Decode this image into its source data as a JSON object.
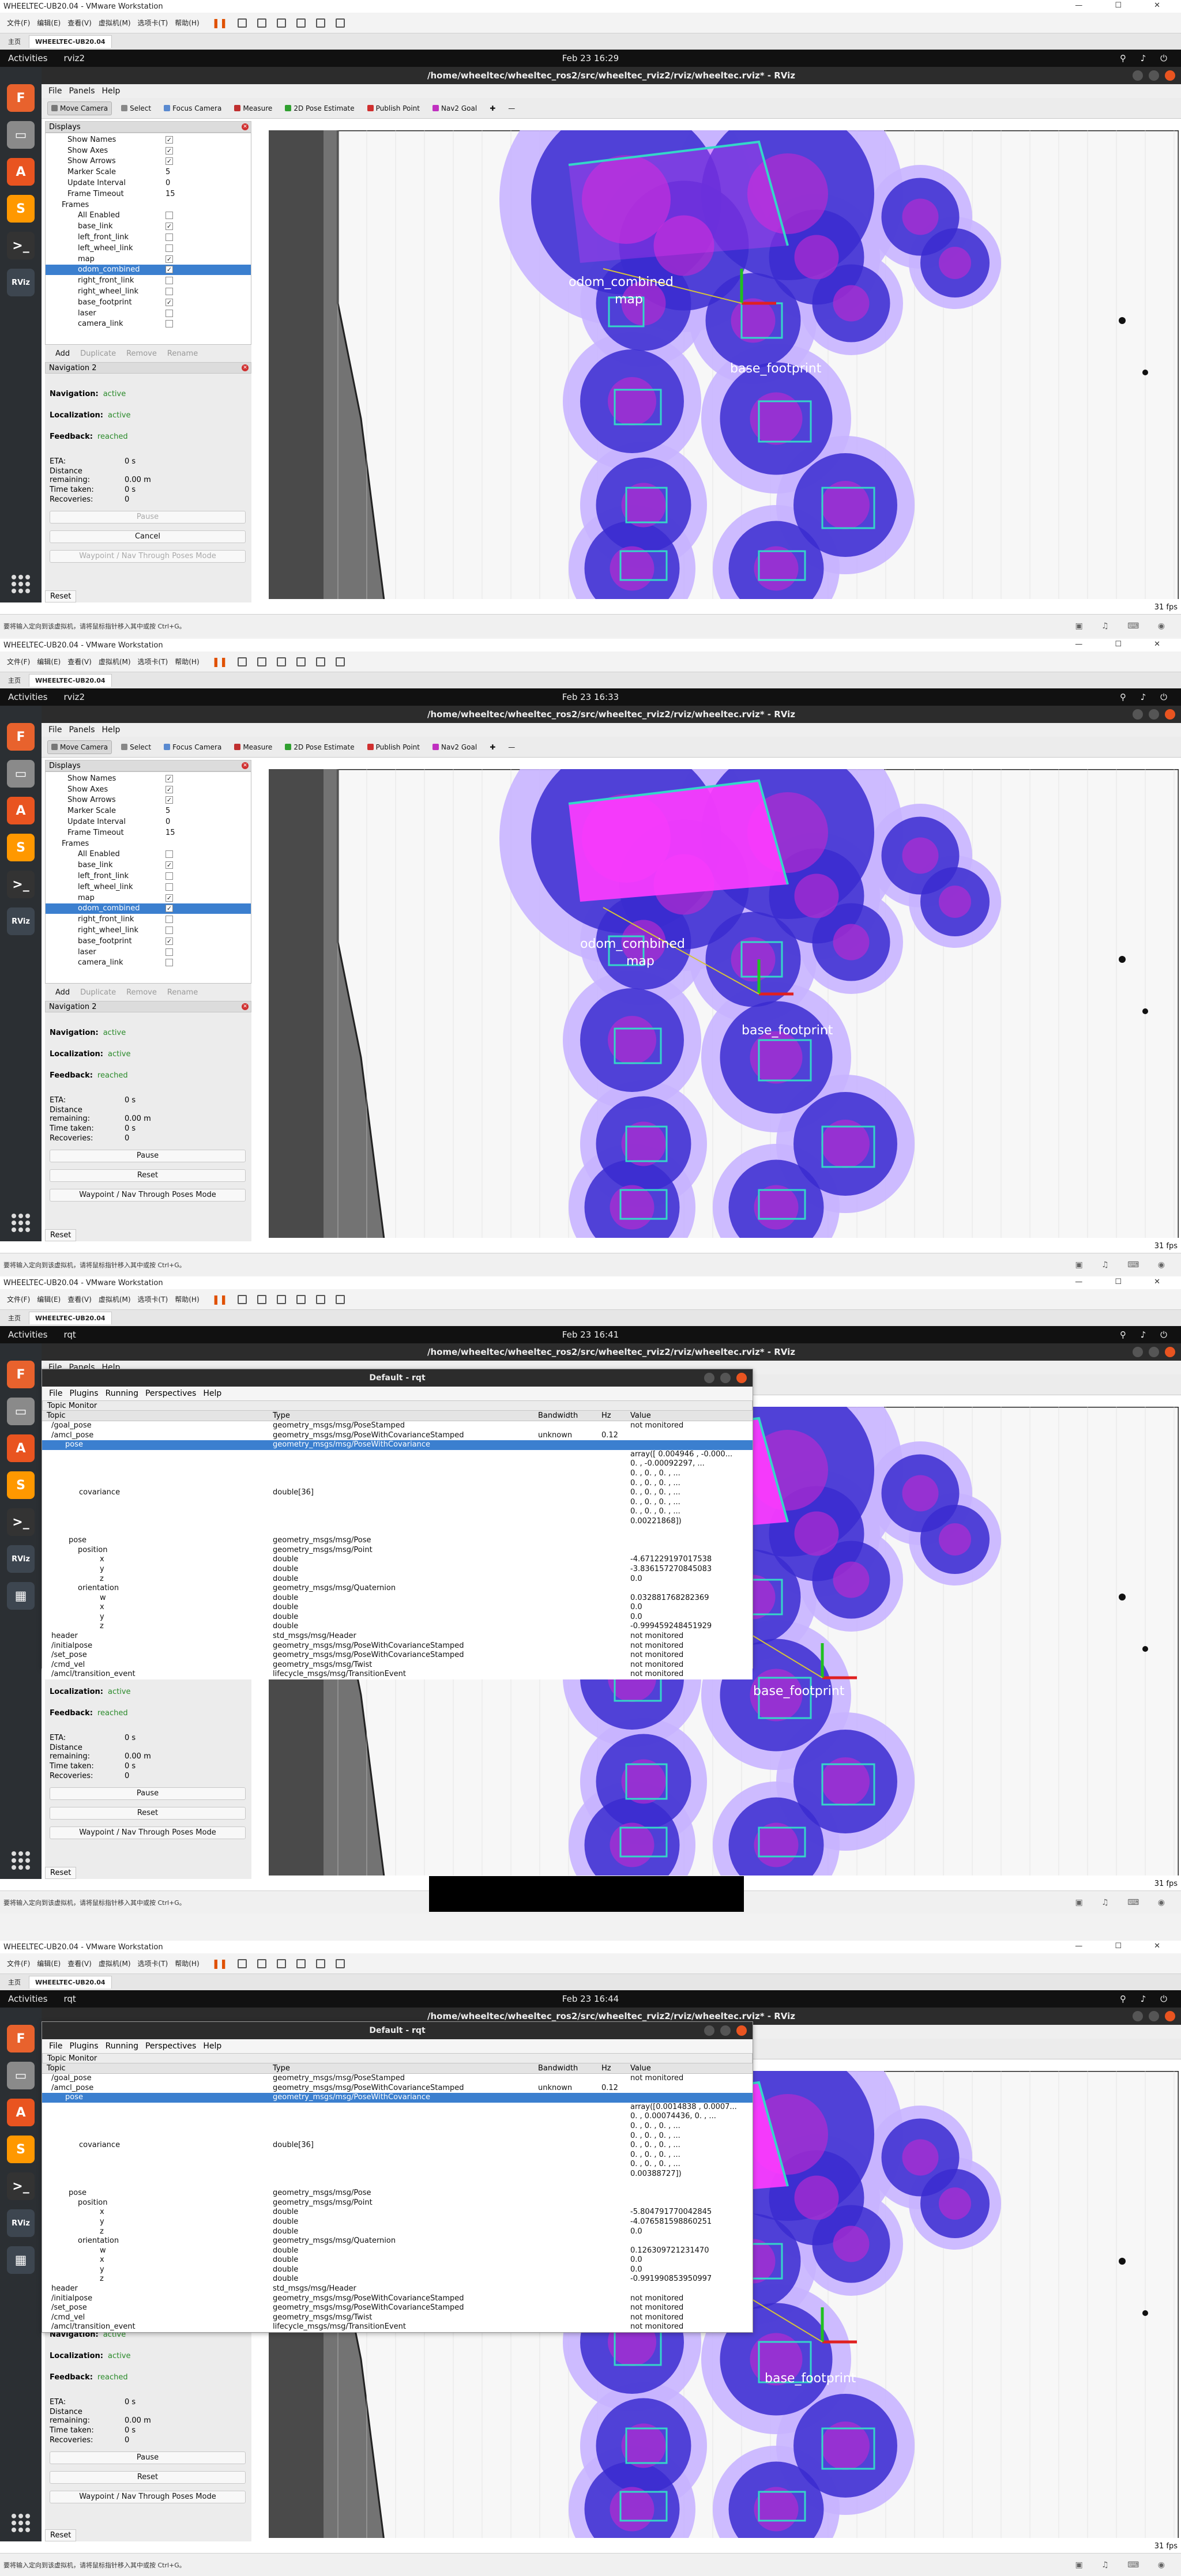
{
  "vmware": {
    "title": "WHEELTEC-UB20.04 - VMware Workstation",
    "menu": [
      "文件(F)",
      "编辑(E)",
      "查看(V)",
      "虚拟机(M)",
      "选项卡(T)",
      "帮助(H)"
    ],
    "tabs": [
      "主页",
      "WHEELTEC-UB20.04"
    ],
    "status_hint": "要将输入定向到该虚拟机，请将鼠标指针移入其中或按 Ctrl+G。"
  },
  "gnome": {
    "activities": "Activities",
    "app_rviz": "rviz2",
    "app_rqt": "rqt"
  },
  "rviz": {
    "title": "/home/wheeltec/wheeltec_ros2/src/wheeltec_rviz2/rviz/wheeltec.rviz* - RViz",
    "menu": [
      "File",
      "Panels",
      "Help"
    ],
    "toolbar": [
      "Move Camera",
      "Select",
      "Focus Camera",
      "Measure",
      "2D Pose Estimate",
      "Publish Point",
      "Nav2 Goal"
    ],
    "displays_title": "Displays",
    "displays_rows": [
      {
        "label": "Show Names",
        "check": "✓"
      },
      {
        "label": "Show Axes",
        "check": "✓"
      },
      {
        "label": "Show Arrows",
        "check": "✓"
      },
      {
        "label": "Marker Scale",
        "value": "5"
      },
      {
        "label": "Update Interval",
        "value": "0"
      },
      {
        "label": "Frame Timeout",
        "value": "15"
      },
      {
        "label": "Frames",
        "value": ""
      },
      {
        "label": "All Enabled",
        "check": ""
      },
      {
        "label": "base_link",
        "check": "✓"
      },
      {
        "label": "left_front_link",
        "check": ""
      },
      {
        "label": "left_wheel_link",
        "check": ""
      },
      {
        "label": "map",
        "check": "✓"
      },
      {
        "label": "odom_combined",
        "check": "✓"
      },
      {
        "label": "right_front_link",
        "check": ""
      },
      {
        "label": "right_wheel_link",
        "check": ""
      },
      {
        "label": "base_footprint",
        "check": "✓"
      },
      {
        "label": "laser",
        "check": ""
      },
      {
        "label": "camera_link",
        "check": ""
      }
    ],
    "display_buttons": [
      "Add",
      "Duplicate",
      "Remove",
      "Rename"
    ],
    "nav_title": "Navigation 2",
    "nav_label": "Navigation:",
    "nav_value": "active",
    "loc_label": "Localization:",
    "loc_value": "active",
    "fb_label": "Feedback:",
    "fb_value": "reached",
    "eta_label": "ETA:",
    "eta_value": "0 s",
    "dist_label": "Distance remaining:",
    "dist_value": "0.00 m",
    "time_label": "Time taken:",
    "time_value": "0 s",
    "rec_label": "Recoveries:",
    "rec_value": "0",
    "btn_pause": "Pause",
    "btn_cancel": "Cancel",
    "btn_reset": "Reset",
    "btn_waypoint": "Waypoint / Nav Through Poses Mode",
    "reset": "Reset",
    "fps": "31 fps",
    "map_labels": [
      "odom_combined",
      "map",
      "base_footprint"
    ]
  },
  "frames": [
    {
      "clock": "Feb 23  16:29"
    },
    {
      "clock": "Feb 23  16:33"
    },
    {
      "clock": "Feb 23  16:41"
    },
    {
      "clock": "Feb 23  16:44"
    }
  ],
  "rqt": {
    "title": "Default - rqt",
    "menu": [
      "File",
      "Plugins",
      "Running",
      "Perspectives",
      "Help"
    ],
    "plugin": "Topic Monitor",
    "cols": [
      "Topic",
      "Type",
      "Bandwidth",
      "Hz",
      "Value"
    ],
    "frame3": [
      {
        "t": "/goal_pose",
        "ty": "geometry_msgs/msg/PoseStamped",
        "bw": "",
        "hz": "",
        "v": "not monitored"
      },
      {
        "t": "/amcl_pose",
        "ty": "geometry_msgs/msg/PoseWithCovarianceStamped",
        "bw": "unknown",
        "hz": "0.12",
        "v": ""
      },
      {
        "t": "pose",
        "ty": "geometry_msgs/msg/PoseWithCovariance",
        "bw": "",
        "hz": "",
        "v": "",
        "hl": true
      },
      {
        "t": "",
        "ty": "",
        "bw": "",
        "hz": "",
        "v": "array([ 0.004946 , -0.000..."
      },
      {
        "t": "",
        "ty": "",
        "bw": "",
        "hz": "",
        "v": "0. , -0.00092297, ..."
      },
      {
        "t": "",
        "ty": "",
        "bw": "",
        "hz": "",
        "v": "0. , 0. , 0. , ..."
      },
      {
        "t": "",
        "ty": "",
        "bw": "",
        "hz": "",
        "v": "0. , 0. , 0. , ..."
      },
      {
        "t": "covariance",
        "ty": "double[36]",
        "bw": "",
        "hz": "",
        "v": "0. , 0. , 0. , ..."
      },
      {
        "t": "",
        "ty": "",
        "bw": "",
        "hz": "",
        "v": "0. , 0. , 0. , ..."
      },
      {
        "t": "",
        "ty": "",
        "bw": "",
        "hz": "",
        "v": "0. , 0. , 0. , ..."
      },
      {
        "t": "",
        "ty": "",
        "bw": "",
        "hz": "",
        "v": "0.00221868])"
      },
      {
        "t": "",
        "ty": "",
        "bw": "",
        "hz": "",
        "v": ""
      },
      {
        "t": "pose",
        "ty": "geometry_msgs/msg/Pose",
        "bw": "",
        "hz": "",
        "v": ""
      },
      {
        "t": "position",
        "ty": "geometry_msgs/msg/Point",
        "bw": "",
        "hz": "",
        "v": ""
      },
      {
        "t": "x",
        "ty": "double",
        "bw": "",
        "hz": "",
        "v": "-4.671229197017538"
      },
      {
        "t": "y",
        "ty": "double",
        "bw": "",
        "hz": "",
        "v": "-3.836157270845083"
      },
      {
        "t": "z",
        "ty": "double",
        "bw": "",
        "hz": "",
        "v": "0.0"
      },
      {
        "t": "orientation",
        "ty": "geometry_msgs/msg/Quaternion",
        "bw": "",
        "hz": "",
        "v": ""
      },
      {
        "t": "w",
        "ty": "double",
        "bw": "",
        "hz": "",
        "v": "0.032881768282369"
      },
      {
        "t": "x",
        "ty": "double",
        "bw": "",
        "hz": "",
        "v": "0.0"
      },
      {
        "t": "y",
        "ty": "double",
        "bw": "",
        "hz": "",
        "v": "0.0"
      },
      {
        "t": "z",
        "ty": "double",
        "bw": "",
        "hz": "",
        "v": "-0.999459248451929"
      },
      {
        "t": "header",
        "ty": "std_msgs/msg/Header",
        "bw": "",
        "hz": "",
        "v": "not monitored"
      },
      {
        "t": "/initialpose",
        "ty": "geometry_msgs/msg/PoseWithCovarianceStamped",
        "bw": "",
        "hz": "",
        "v": "not monitored"
      },
      {
        "t": "/set_pose",
        "ty": "geometry_msgs/msg/PoseWithCovarianceStamped",
        "bw": "",
        "hz": "",
        "v": "not monitored"
      },
      {
        "t": "/cmd_vel",
        "ty": "geometry_msgs/msg/Twist",
        "bw": "",
        "hz": "",
        "v": "not monitored"
      },
      {
        "t": "/amcl/transition_event",
        "ty": "lifecycle_msgs/msg/TransitionEvent",
        "bw": "",
        "hz": "",
        "v": "not monitored"
      }
    ],
    "frame4": [
      {
        "t": "/goal_pose",
        "ty": "geometry_msgs/msg/PoseStamped",
        "bw": "",
        "hz": "",
        "v": "not monitored"
      },
      {
        "t": "/amcl_pose",
        "ty": "geometry_msgs/msg/PoseWithCovarianceStamped",
        "bw": "unknown",
        "hz": "0.12",
        "v": ""
      },
      {
        "t": "pose",
        "ty": "geometry_msgs/msg/PoseWithCovariance",
        "bw": "",
        "hz": "",
        "v": "",
        "hl": true
      },
      {
        "t": "",
        "ty": "",
        "bw": "",
        "hz": "",
        "v": "array([0.0014838 , 0.0007..."
      },
      {
        "t": "",
        "ty": "",
        "bw": "",
        "hz": "",
        "v": "0. , 0.00074436, 0. , ..."
      },
      {
        "t": "",
        "ty": "",
        "bw": "",
        "hz": "",
        "v": "0. , 0. , 0. , ..."
      },
      {
        "t": "",
        "ty": "",
        "bw": "",
        "hz": "",
        "v": "0. , 0. , 0. , ..."
      },
      {
        "t": "covariance",
        "ty": "double[36]",
        "bw": "",
        "hz": "",
        "v": "0. , 0. , 0. , ..."
      },
      {
        "t": "",
        "ty": "",
        "bw": "",
        "hz": "",
        "v": "0. , 0. , 0. , ..."
      },
      {
        "t": "",
        "ty": "",
        "bw": "",
        "hz": "",
        "v": "0. , 0. , 0. , ..."
      },
      {
        "t": "",
        "ty": "",
        "bw": "",
        "hz": "",
        "v": "0.00388727])"
      },
      {
        "t": "",
        "ty": "",
        "bw": "",
        "hz": "",
        "v": ""
      },
      {
        "t": "pose",
        "ty": "geometry_msgs/msg/Pose",
        "bw": "",
        "hz": "",
        "v": ""
      },
      {
        "t": "position",
        "ty": "geometry_msgs/msg/Point",
        "bw": "",
        "hz": "",
        "v": ""
      },
      {
        "t": "x",
        "ty": "double",
        "bw": "",
        "hz": "",
        "v": "-5.804791770042845"
      },
      {
        "t": "y",
        "ty": "double",
        "bw": "",
        "hz": "",
        "v": "-4.076581598860251"
      },
      {
        "t": "z",
        "ty": "double",
        "bw": "",
        "hz": "",
        "v": "0.0"
      },
      {
        "t": "orientation",
        "ty": "geometry_msgs/msg/Quaternion",
        "bw": "",
        "hz": "",
        "v": ""
      },
      {
        "t": "w",
        "ty": "double",
        "bw": "",
        "hz": "",
        "v": "0.126309721231470"
      },
      {
        "t": "x",
        "ty": "double",
        "bw": "",
        "hz": "",
        "v": "0.0"
      },
      {
        "t": "y",
        "ty": "double",
        "bw": "",
        "hz": "",
        "v": "0.0"
      },
      {
        "t": "z",
        "ty": "double",
        "bw": "",
        "hz": "",
        "v": "-0.991990853950997"
      },
      {
        "t": "header",
        "ty": "std_msgs/msg/Header",
        "bw": "",
        "hz": "",
        "v": ""
      },
      {
        "t": "/initialpose",
        "ty": "geometry_msgs/msg/PoseWithCovarianceStamped",
        "bw": "",
        "hz": "",
        "v": "not monitored"
      },
      {
        "t": "/set_pose",
        "ty": "geometry_msgs/msg/PoseWithCovarianceStamped",
        "bw": "",
        "hz": "",
        "v": "not monitored"
      },
      {
        "t": "/cmd_vel",
        "ty": "geometry_msgs/msg/Twist",
        "bw": "",
        "hz": "",
        "v": "not monitored"
      },
      {
        "t": "/amcl/transition_event",
        "ty": "lifecycle_msgs/msg/TransitionEvent",
        "bw": "",
        "hz": "",
        "v": "not monitored"
      }
    ]
  },
  "colors": {
    "ubuntu_orange": "#e95420",
    "costmap_blue": "#3a2bd0",
    "costmap_magenta": "#ff3cff",
    "highlight": "#3b7fcf",
    "active_green": "#2a8a2a"
  },
  "icons": [
    "firefox-icon",
    "files-icon",
    "software-icon",
    "sublime-icon",
    "terminal-icon",
    "rviz-icon",
    "apps-grid-icon",
    "close-icon"
  ]
}
